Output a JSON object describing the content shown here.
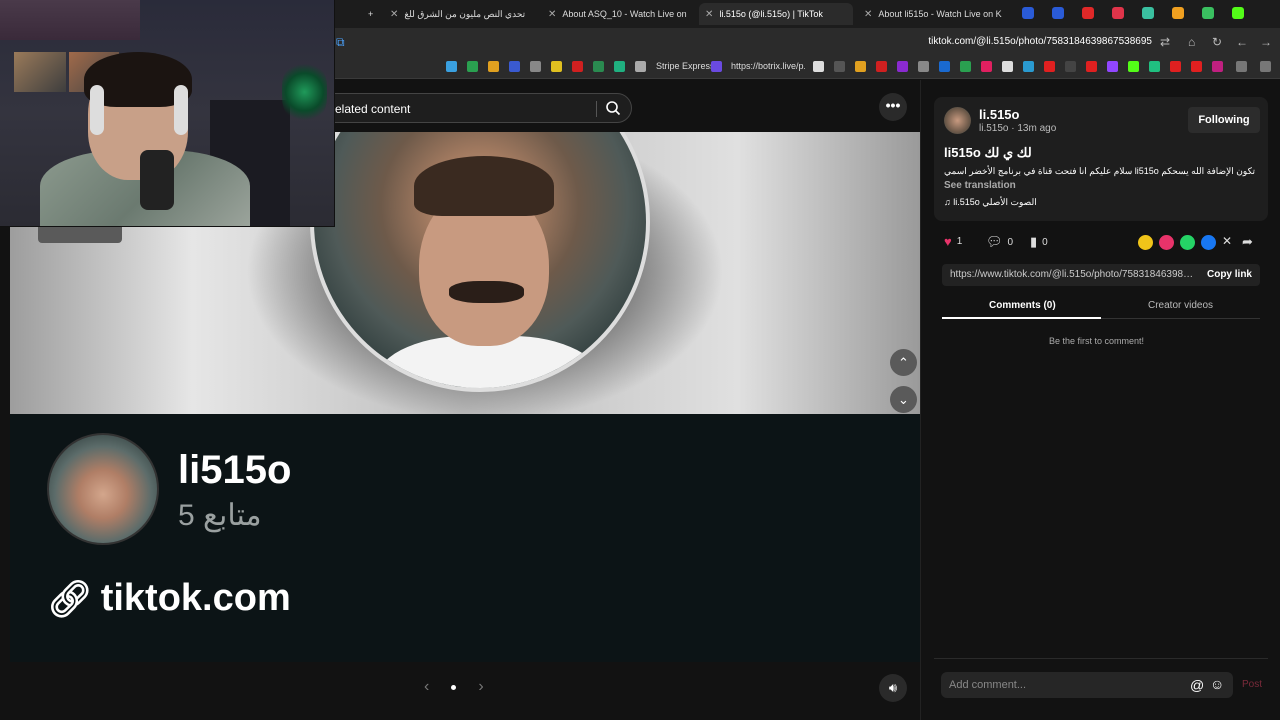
{
  "browser": {
    "tabs": [
      {
        "label": "تحدي النص مليون من الشرق للغ",
        "active": false
      },
      {
        "label": "About ASQ_10 - Watch Live on",
        "active": false
      },
      {
        "label": "li.515o (@li.515o) | TikTok",
        "active": true
      },
      {
        "label": "About li515o - Watch Live on K",
        "active": false
      }
    ],
    "new_tab": "+",
    "url": "tiktok.com/@li.515o/photo/7583184639867538695",
    "bookmarks": [
      "Stripe Express",
      "https://botrix.live/p..."
    ]
  },
  "main": {
    "search_placeholder": "elated content",
    "more": "•••",
    "profile_card": {
      "username": "li515o",
      "followers": "5 متابع",
      "link": "tiktok.com"
    },
    "pager": {
      "prev": "‹",
      "next": "›"
    }
  },
  "side": {
    "author_name": "li.515o",
    "author_sub": "li.515o · 13m ago",
    "follow_label": "Following",
    "post_title": "li515o لك ي لك",
    "description": "تكون الإضافة الله يسحكم li515o سلام عليكم انا فتحت قناة في برنامج الأخضر اسمي",
    "see_translation": "See translation",
    "sound": "li.515o الصوت الأصلي",
    "likes": "1",
    "comments": "0",
    "saves": "0",
    "share_url": "https://www.tiktok.com/@li.515o/photo/758318463986...",
    "copy_link": "Copy link",
    "tab_comments": "Comments (0)",
    "tab_creator": "Creator videos",
    "empty_comments": "Be the first to comment!",
    "comment_placeholder": "Add comment...",
    "post_label": "Post"
  },
  "colors": {
    "like": "#e8336a",
    "post_disabled": "#7a2a3a",
    "share_yellow": "#f0c419",
    "share_pink": "#e8336a",
    "share_whatsapp": "#25d366",
    "share_facebook": "#1877f2"
  }
}
